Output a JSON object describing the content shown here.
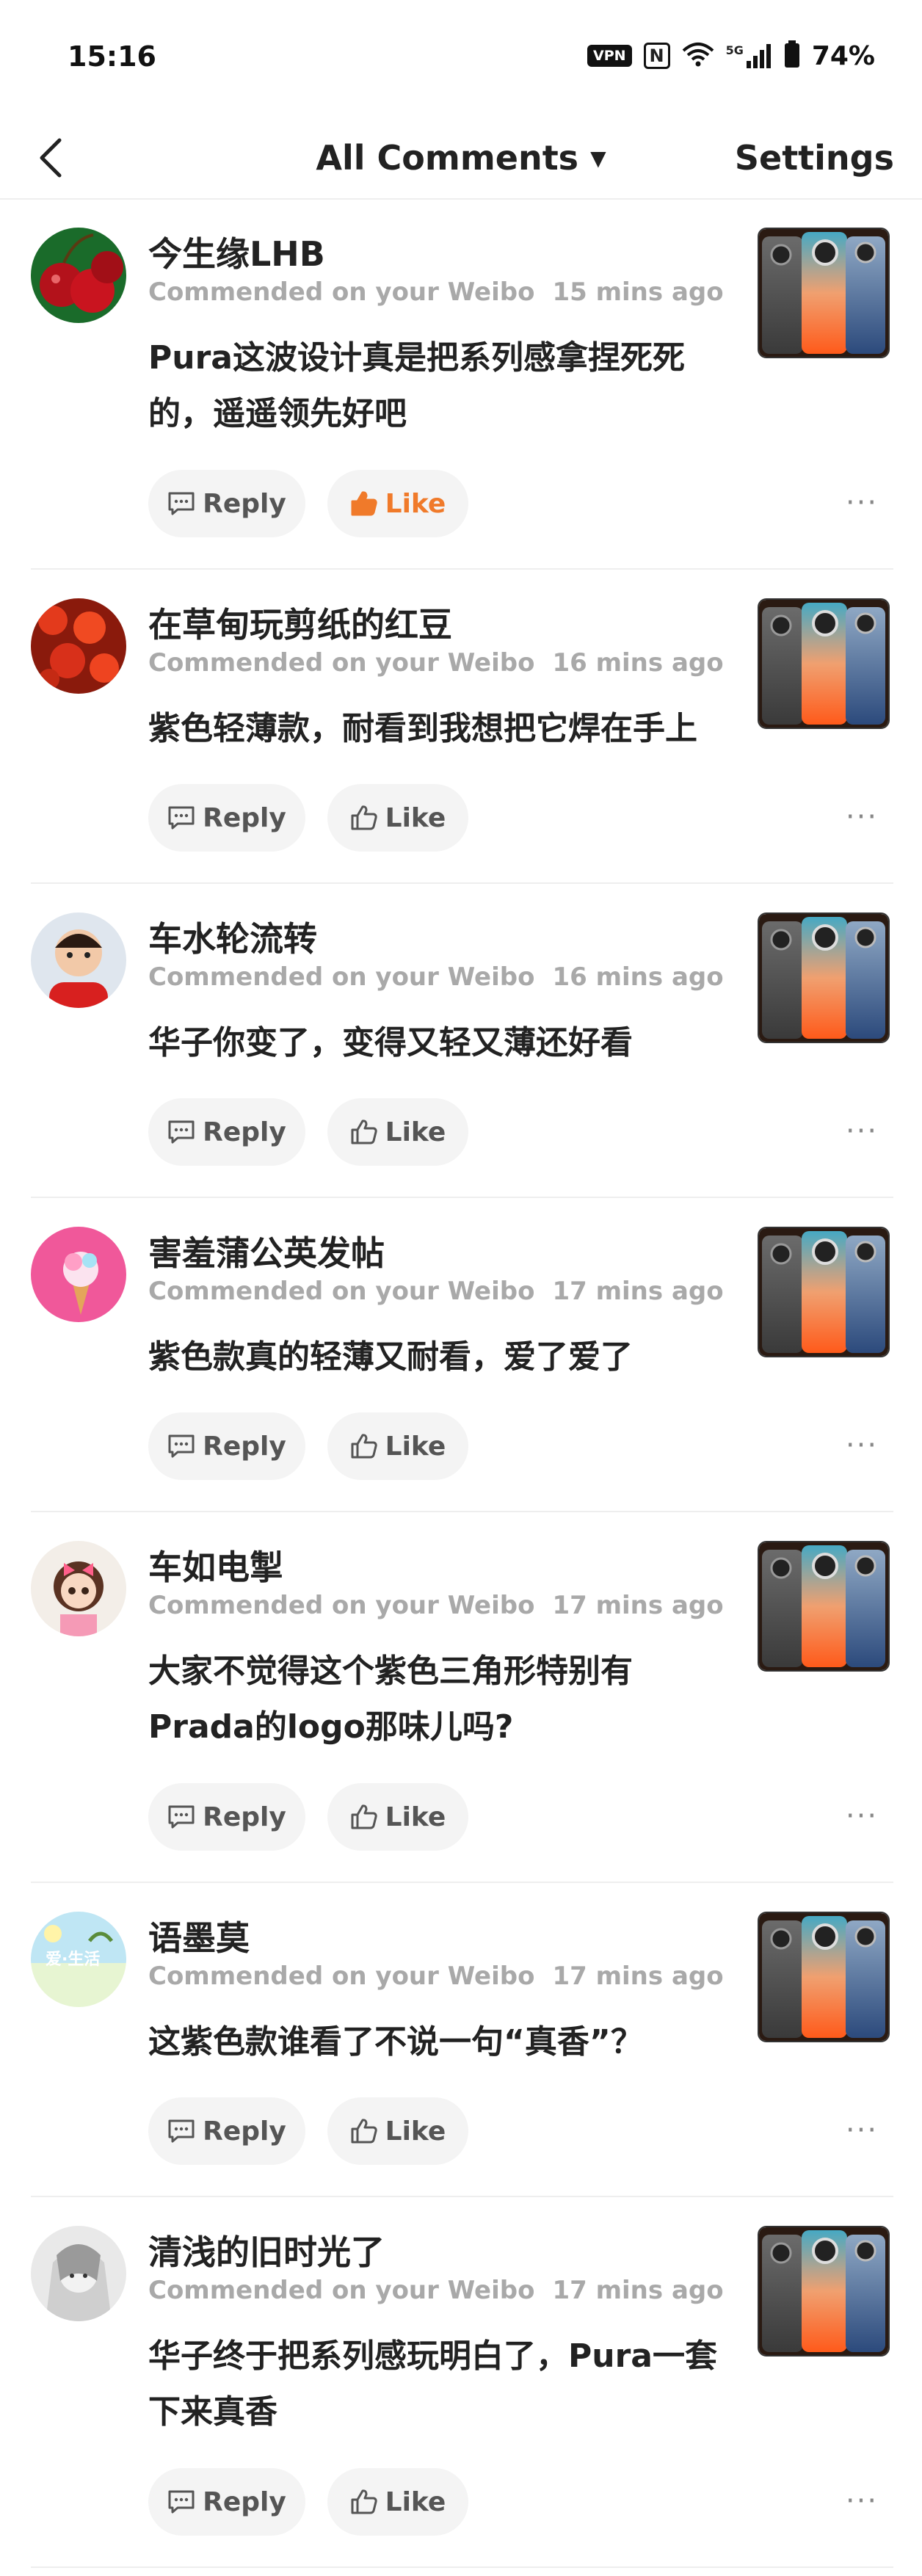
{
  "status_bar": {
    "time": "15:16",
    "vpn": "VPN",
    "nfc": "N",
    "network": "5G",
    "battery": "74%"
  },
  "nav": {
    "title": "All Comments",
    "caret": "▼",
    "settings": "Settings"
  },
  "labels": {
    "reply": "Reply",
    "like": "Like",
    "more": "···"
  },
  "comments": [
    {
      "user": "今生缘LHB",
      "meta": "Commended on your Weibo",
      "time": "15 mins ago",
      "text": "Pura这波设计真是把系列感拿捏死死的，遥遥领先好吧",
      "liked": true
    },
    {
      "user": "在草甸玩剪纸的红豆",
      "meta": "Commended on your Weibo",
      "time": "16 mins ago",
      "text": "紫色轻薄款，耐看到我想把它焊在手上",
      "liked": false
    },
    {
      "user": "车水轮流转",
      "meta": "Commended on your Weibo",
      "time": "16 mins ago",
      "text": "华子你变了，变得又轻又薄还好看",
      "liked": false
    },
    {
      "user": "害羞蒲公英发帖",
      "meta": "Commended on your Weibo",
      "time": "17 mins ago",
      "text": "紫色款真的轻薄又耐看，爱了爱了",
      "liked": false
    },
    {
      "user": "车如电掣",
      "meta": "Commended on your Weibo",
      "time": "17 mins ago",
      "text": "大家不觉得这个紫色三角形特别有Prada的logo那味儿吗?",
      "liked": false
    },
    {
      "user": "语墨莫",
      "meta": "Commended on your Weibo",
      "time": "17 mins ago",
      "text": "这紫色款谁看了不说一句“真香”？",
      "liked": false
    },
    {
      "user": "清浅的旧时光了",
      "meta": "Commended on your Weibo",
      "time": "17 mins ago",
      "text": "华子终于把系列感玩明白了，Pura一套下来真香",
      "liked": false
    }
  ],
  "colors": {
    "like_active": "#f07a2a",
    "meta_gray": "#a9a9a9",
    "button_bg": "#f4f4f4"
  }
}
